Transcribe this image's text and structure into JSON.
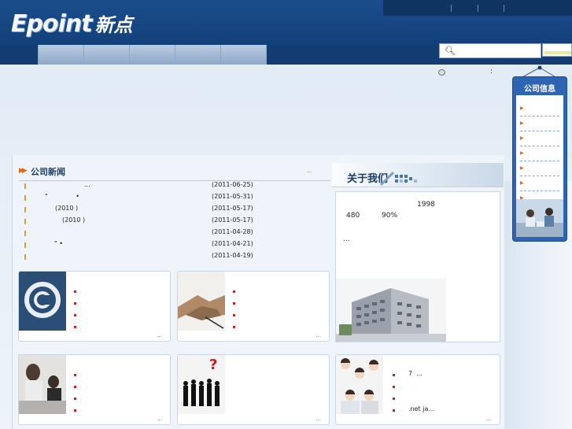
{
  "header": {
    "logo_text": "Epoint",
    "logo_cn": "新点"
  },
  "icons": {
    "search": "magnifier-icon",
    "util": "globe-icon"
  },
  "util": {
    "colon": ":"
  },
  "news": {
    "title": "公司新闻",
    "more": "...",
    "items": [
      {
        "text": "...",
        "date": "(2011-06-25)"
      },
      {
        "text": "\"              •",
        "date": "(2011-05-31)"
      },
      {
        "text": "(2010 )",
        "date": "(2011-05-17)"
      },
      {
        "text": "(2010 )",
        "date": "(2011-05-17)"
      },
      {
        "text": "",
        "date": "(2011-04-28)"
      },
      {
        "text": "\" •",
        "date": "(2011-04-21)"
      },
      {
        "text": "",
        "date": "(2011-04-19)"
      }
    ]
  },
  "about": {
    "title": "关于我们",
    "year": "1998",
    "count": "480",
    "percent": "90%",
    "more": "..."
  },
  "cards": {
    "more": "...",
    "last_card_lines": [
      "7  ...",
      "",
      "",
      ".net ja..."
    ]
  },
  "side": {
    "title": "公司信息"
  },
  "colors": {
    "header_bg": "#1a4a87",
    "accent_orange": "#e06c1a",
    "side_blue": "#2d65b3"
  }
}
